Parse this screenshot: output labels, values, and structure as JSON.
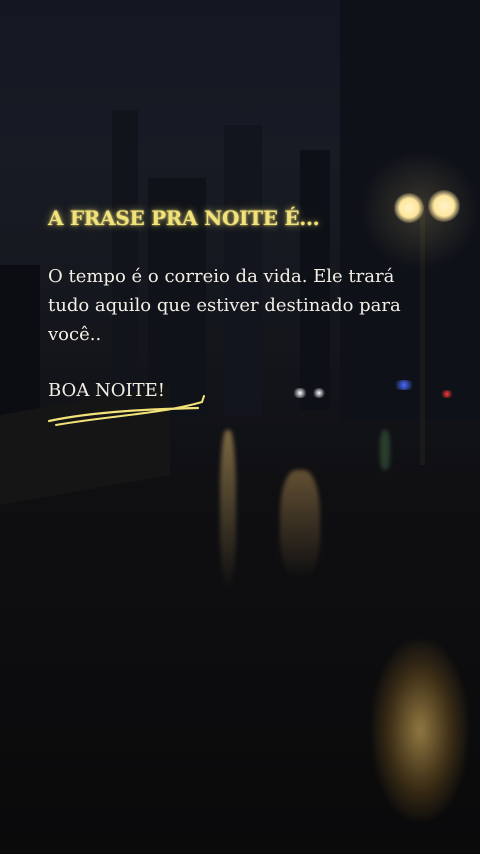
{
  "headline": "A FRASE PRA NOITE É...",
  "quote": "O tempo é o correio da vida. Ele trará tudo aquilo que estiver destinado para você..",
  "closing": "BOA NOITE!",
  "colors": {
    "headline": "#f2e27a",
    "body_text": "#f3efe6",
    "underline": "#f2e27a",
    "lamp_glow": "#ffe7a0"
  },
  "icons": {
    "underline": "hand-drawn-underline-swoosh"
  }
}
